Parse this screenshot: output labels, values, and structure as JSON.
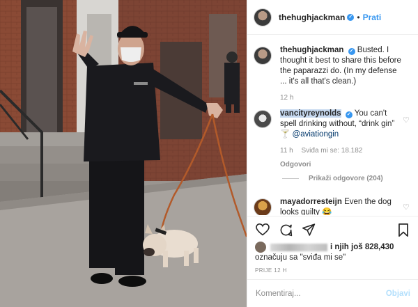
{
  "post": {
    "author": "thehughjackman",
    "follow_label": "Prati",
    "separator": "•"
  },
  "caption": {
    "username": "thehughjackman",
    "text": "Busted. I thought it best to share this before the paparazzi do. (In my defense ... it's all that's clean.)",
    "time": "12 h"
  },
  "comments": [
    {
      "username": "vancityreynolds",
      "text_before": "You can't spell drinking without, “drink gin” ",
      "emoji": "🍸",
      "mention": "@aviationgin",
      "time": "11 h",
      "likes": "Sviđa mi se: 18.182",
      "reply_label": "Odgovori",
      "view_replies": "Prikaži odgovore (204)"
    },
    {
      "username": "mayadorresteijn",
      "text": "Even the dog looks guilty",
      "emoji": "😂"
    }
  ],
  "likes": {
    "suffix": "i njih još 828,430",
    "line2": "označuju sa \"sviđa mi se\""
  },
  "timestamp": "PRIJE 12 H",
  "comment_box": {
    "placeholder": "Komentiraj...",
    "post_label": "Objavi"
  },
  "icons": [
    "verified-badge",
    "heart-outline",
    "comment-bubble",
    "share-send",
    "bookmark"
  ],
  "colors": {
    "link_blue": "#3897f0",
    "muted": "#8e8e8e",
    "post_disabled": "#b2dffc"
  }
}
